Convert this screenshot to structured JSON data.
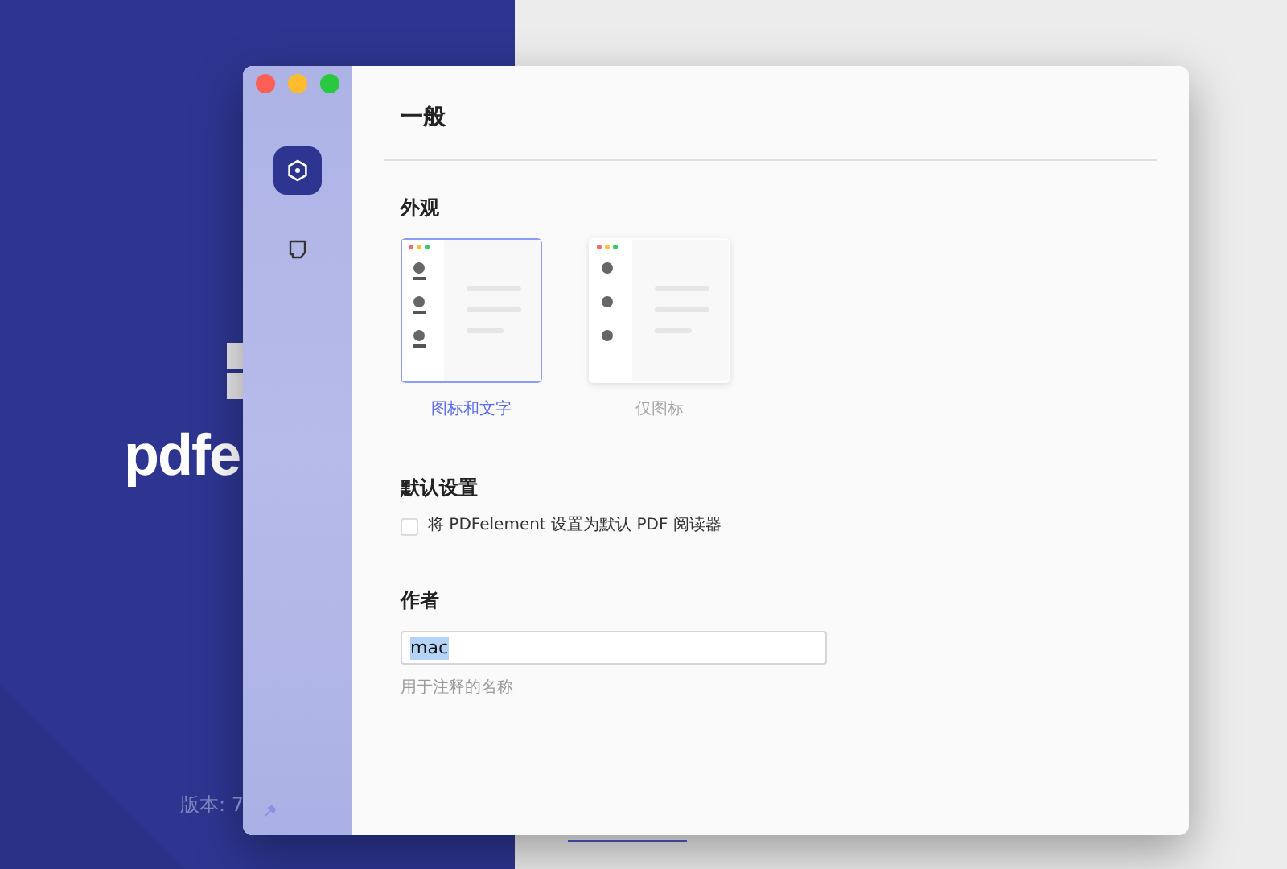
{
  "background_app": {
    "logo_text": "pdfe",
    "version_text": "版本: 7"
  },
  "sidebar": {
    "items": [
      {
        "kind": "gear",
        "selected": true
      },
      {
        "kind": "note",
        "selected": false
      }
    ]
  },
  "page": {
    "title": "一般",
    "appearance": {
      "heading": "外观",
      "options": [
        {
          "label": "图标和文字",
          "kind": "icons_text",
          "selected": true
        },
        {
          "label": "仅图标",
          "kind": "icons_only",
          "selected": false
        }
      ]
    },
    "default_settings": {
      "heading": "默认设置",
      "checkbox": {
        "label": "将 PDFelement 设置为默认 PDF 阅读器",
        "checked": false
      }
    },
    "author": {
      "heading": "作者",
      "value": "mac",
      "hint": "用于注释的名称"
    }
  }
}
